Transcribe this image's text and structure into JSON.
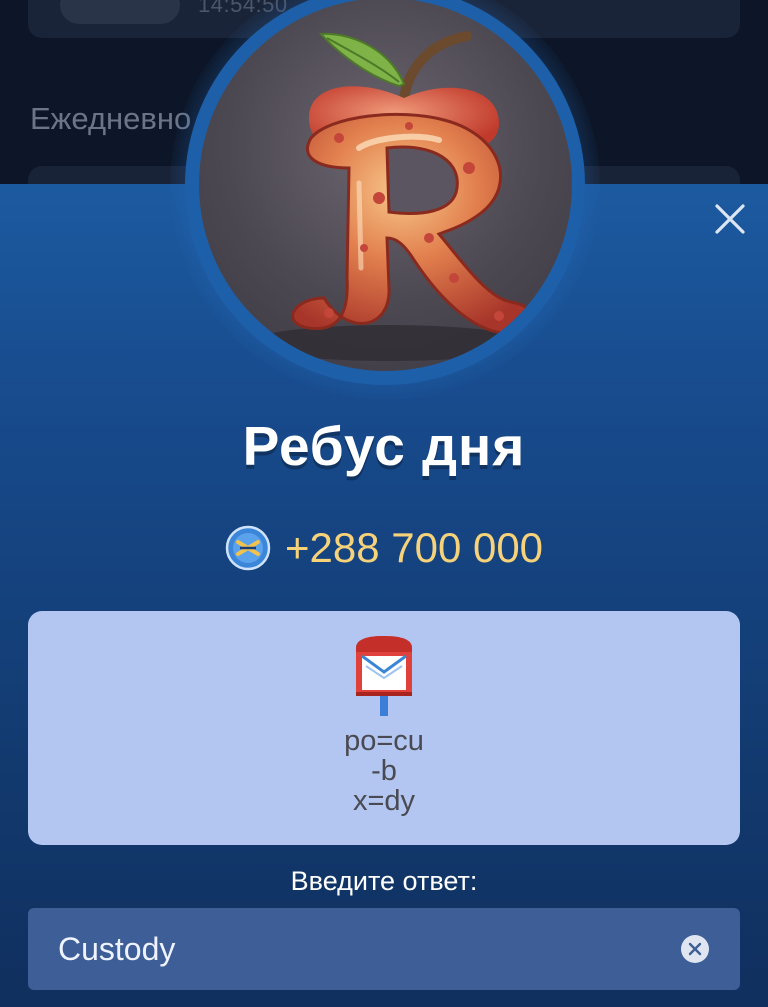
{
  "background": {
    "time_text": "14:54:50",
    "section_label": "Ежедневно"
  },
  "dialog": {
    "title": "Ребус дня",
    "reward": {
      "icon": "coin-icon",
      "value": "+288 700 000"
    },
    "puzzle": {
      "emoji_icon": "mailbox-icon",
      "lines": [
        "po=cu",
        "-b",
        "x=dy"
      ]
    },
    "answer_label": "Введите ответ:",
    "answer_value": "Custody",
    "close_icon": "close-icon",
    "clear_icon": "clear-icon"
  },
  "colors": {
    "sheet_top": "#1c5aa0",
    "sheet_bottom": "#102f5e",
    "puzzle_card": "#b2c6f1",
    "answer_field": "#3d5e96",
    "reward_text": "#f6d27a"
  }
}
